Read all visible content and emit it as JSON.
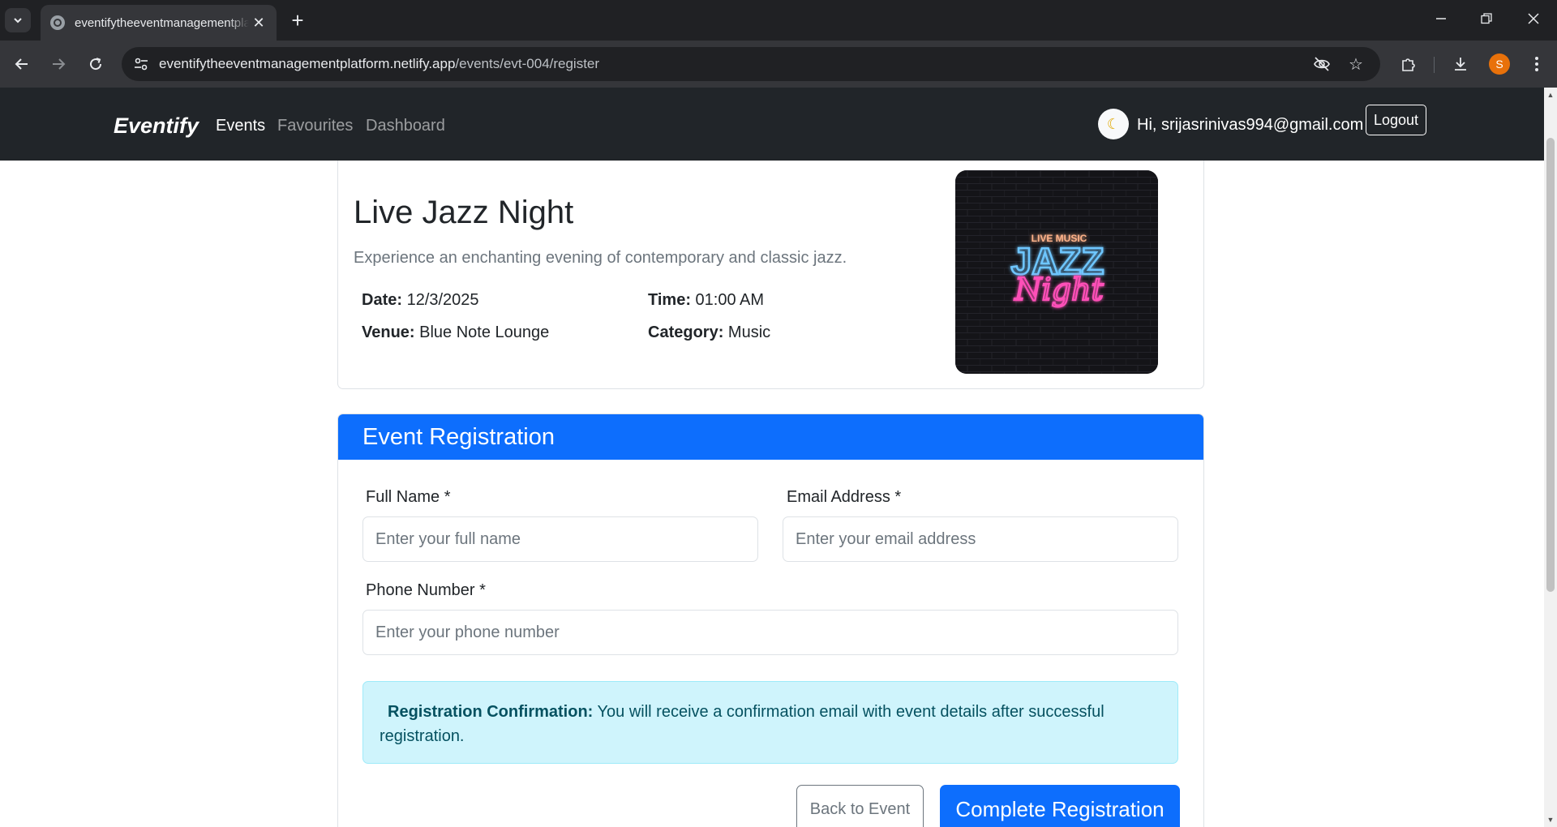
{
  "browser": {
    "tab_title": "eventifytheeventmanagementplatform.netlify.app",
    "url_host": "eventifytheeventmanagementplatform.netlify.app",
    "url_path": "/events/evt-004/register",
    "profile_initial": "S",
    "icons": {
      "tab_search": "chevron-down-icon",
      "favicon": "globe-icon",
      "close": "close-icon",
      "new_tab": "plus-icon",
      "minimize": "minimize-icon",
      "restore": "restore-icon",
      "window_close": "close-icon",
      "back": "arrow-left-icon",
      "forward": "arrow-right-icon",
      "reload": "reload-icon",
      "site_info": "tune-icon",
      "eye_off": "eye-off-icon",
      "bookmark": "star-icon",
      "extensions": "puzzle-icon",
      "download": "download-icon",
      "menu": "kebab-menu-icon"
    }
  },
  "navbar": {
    "brand": "Eventify",
    "links": [
      {
        "label": "Events",
        "active": true
      },
      {
        "label": "Favourites",
        "active": false
      },
      {
        "label": "Dashboard",
        "active": false
      }
    ],
    "theme_icon": "moon-icon",
    "greeting": "Hi, srijasrinivas994@gmail.com",
    "logout_label": "Logout"
  },
  "event": {
    "title": "Live Jazz Night",
    "description": "Experience an enchanting evening of contemporary and classic jazz.",
    "date_label": "Date:",
    "date_value": "12/3/2025",
    "time_label": "Time:",
    "time_value": "01:00 AM",
    "venue_label": "Venue:",
    "venue_value": "Blue Note Lounge",
    "category_label": "Category:",
    "category_value": "Music",
    "image": {
      "line1": "LIVE MUSIC",
      "line2": "JAZZ",
      "line3": "Night"
    }
  },
  "registration": {
    "header": "Event Registration",
    "full_name_label": "Full Name *",
    "full_name_placeholder": "Enter your full name",
    "email_label": "Email Address *",
    "email_placeholder": "Enter your email address",
    "phone_label": "Phone Number *",
    "phone_placeholder": "Enter your phone number",
    "alert_title": "Registration Confirmation:",
    "alert_text": " You will receive a confirmation email with event details after successful registration.",
    "back_label": "Back to Event",
    "submit_label": "Complete Registration"
  },
  "colors": {
    "primary": "#0d6efd",
    "navbar_bg": "#212529",
    "info_bg": "#cff4fc",
    "info_text": "#055160",
    "profile": "#e8710a"
  }
}
